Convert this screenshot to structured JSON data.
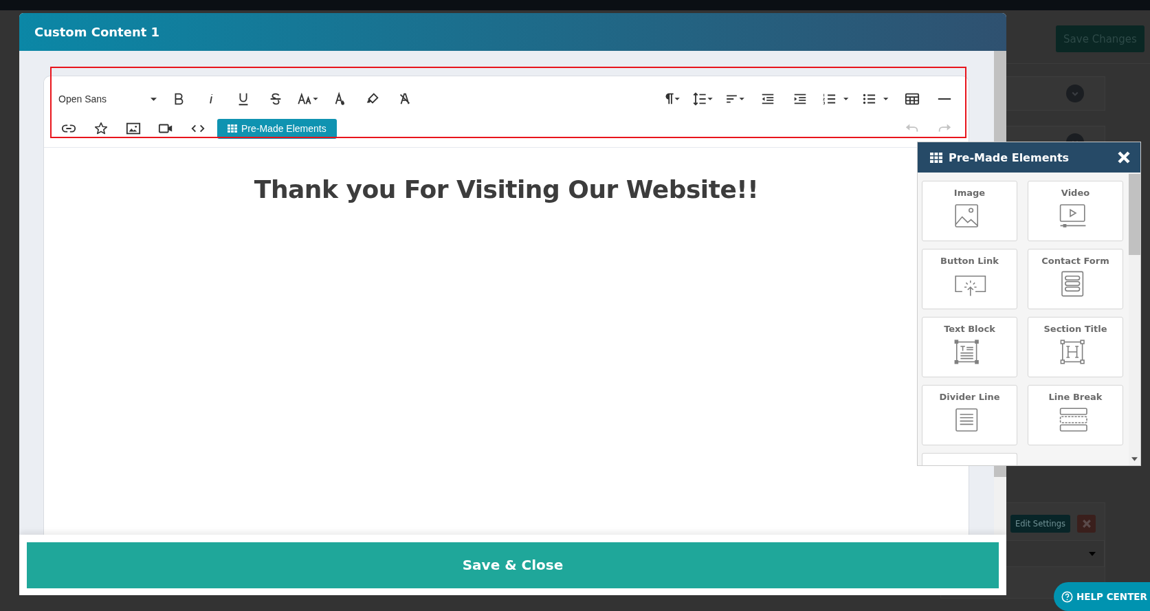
{
  "background_page": {
    "save_button": "Save Changes",
    "edit_button": "Edit Settings",
    "help_center": "HELP CENTER"
  },
  "modal": {
    "title": "Custom Content 1",
    "toolbar": {
      "font": "Open Sans",
      "premade_button": "Pre-Made Elements",
      "history": [
        {
          "disabled": true
        },
        {
          "disabled": true
        }
      ]
    },
    "content": {
      "heading": "Thank you For Visiting Our Website!!"
    },
    "save_button": "Save & Close"
  },
  "premade_panel": {
    "title": "Pre-Made Elements",
    "elements": [
      {
        "label": "Image",
        "kind": "image"
      },
      {
        "label": "Video",
        "kind": "video"
      },
      {
        "label": "Button Link",
        "kind": "button"
      },
      {
        "label": "Contact Form",
        "kind": "form"
      },
      {
        "label": "Text Block",
        "kind": "text"
      },
      {
        "label": "Section Title",
        "kind": "title"
      },
      {
        "label": "Divider Line",
        "kind": "divider"
      },
      {
        "label": "Line Break",
        "kind": "break"
      }
    ]
  }
}
